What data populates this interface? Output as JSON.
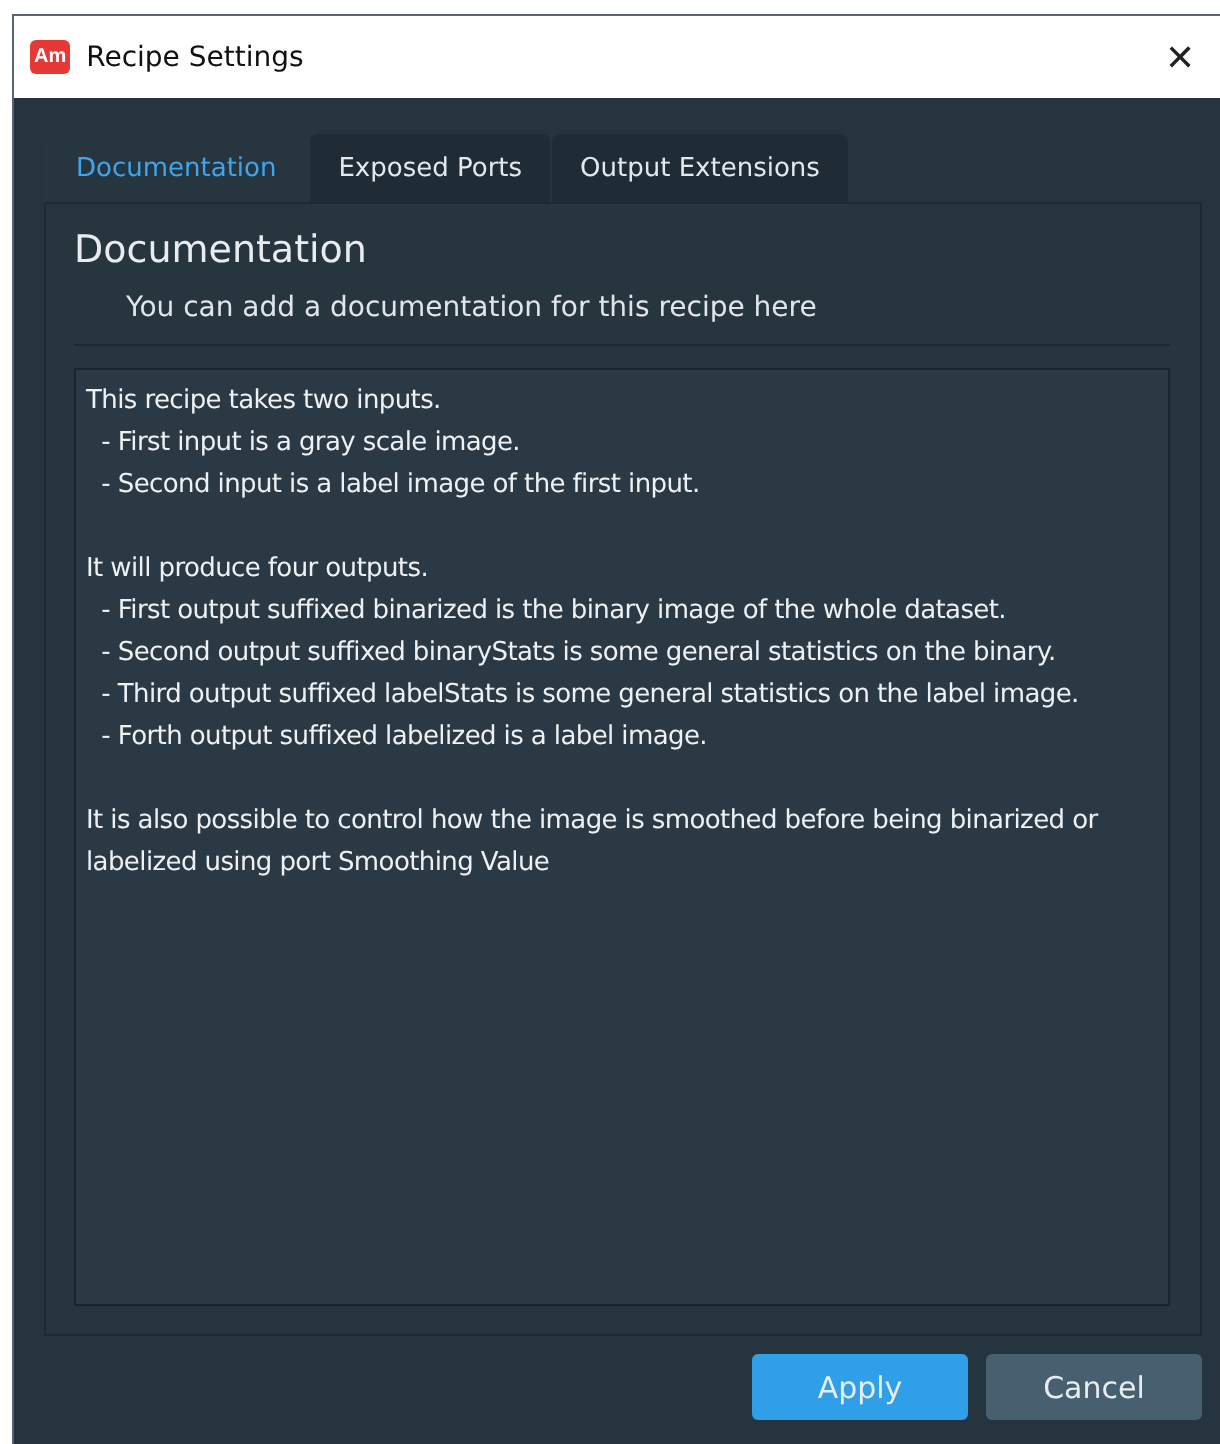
{
  "window": {
    "title": "Recipe Settings",
    "app_badge": "Am",
    "close": "✕"
  },
  "tabs": [
    {
      "label": "Documentation",
      "selected": true
    },
    {
      "label": "Exposed Ports",
      "selected": false
    },
    {
      "label": "Output Extensions",
      "selected": false
    }
  ],
  "panel": {
    "heading": "Documentation",
    "subtitle": "You can add a documentation for this recipe here",
    "documentation": "This recipe takes two inputs.\n  - First input is a gray scale image.\n  - Second input is a label image of the first input.\n\nIt will produce four outputs.\n  - First output suffixed binarized is the binary image of the whole dataset.\n  - Second output suffixed binaryStats is some general statistics on the binary.\n  - Third output suffixed labelStats is some general statistics on the label image.\n  - Forth output suffixed labelized is a label image.\n\nIt is also possible to control how the image is smoothed before being binarized or labelized using port Smoothing Value"
  },
  "buttons": [
    {
      "label": "Apply",
      "kind": "primary"
    },
    {
      "label": "Cancel",
      "kind": "secondary"
    }
  ]
}
